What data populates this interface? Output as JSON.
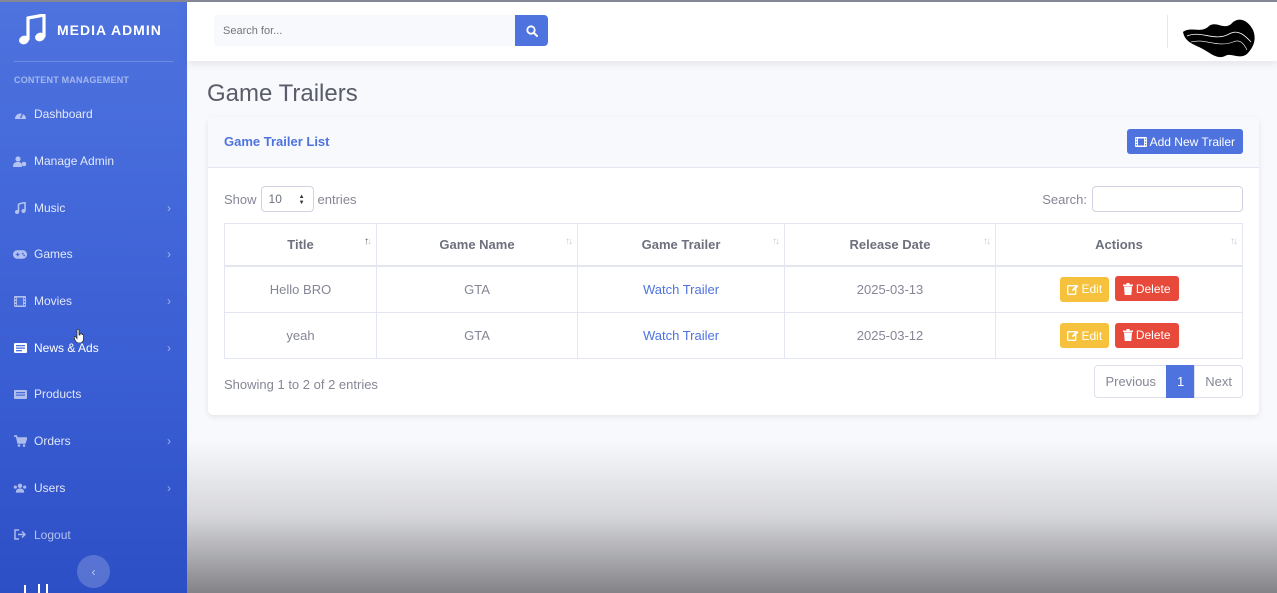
{
  "brand": {
    "name": "MEDIA ADMIN"
  },
  "sidebar": {
    "heading": "CONTENT MANAGEMENT",
    "items": [
      {
        "label": "Dashboard",
        "icon": "dashboard-icon",
        "chevron": false
      },
      {
        "label": "Manage Admin",
        "icon": "user-cog-icon",
        "chevron": false
      },
      {
        "label": "Music",
        "icon": "music-icon",
        "chevron": true
      },
      {
        "label": "Games",
        "icon": "gamepad-icon",
        "chevron": true
      },
      {
        "label": "Movies",
        "icon": "film-icon",
        "chevron": true
      },
      {
        "label": "News & Ads",
        "icon": "newspaper-icon",
        "chevron": true
      },
      {
        "label": "Products",
        "icon": "box-icon",
        "chevron": false
      },
      {
        "label": "Orders",
        "icon": "cart-icon",
        "chevron": true
      },
      {
        "label": "Users",
        "icon": "users-icon",
        "chevron": true
      },
      {
        "label": "Logout",
        "icon": "logout-icon",
        "chevron": false
      }
    ]
  },
  "topbar": {
    "search_placeholder": "Search for..."
  },
  "page": {
    "title": "Game Trailers"
  },
  "card": {
    "title": "Game Trailer List",
    "add_button": "Add New Trailer"
  },
  "datatable": {
    "show_label": "Show",
    "entries_label": "entries",
    "length_value": "10",
    "search_label": "Search:",
    "columns": [
      "Title",
      "Game Name",
      "Game Trailer",
      "Release Date",
      "Actions"
    ],
    "rows": [
      {
        "title": "Hello BRO",
        "game": "GTA",
        "trailer": "Watch Trailer",
        "date": "2025-03-13"
      },
      {
        "title": "yeah",
        "game": "GTA",
        "trailer": "Watch Trailer",
        "date": "2025-03-12"
      }
    ],
    "edit_label": "Edit",
    "delete_label": "Delete",
    "info": "Showing 1 to 2 of 2 entries",
    "pagination": {
      "previous": "Previous",
      "current": "1",
      "next": "Next"
    }
  },
  "colors": {
    "primary": "#4e73df",
    "warning": "#f6c23e",
    "danger": "#e74a3b"
  }
}
